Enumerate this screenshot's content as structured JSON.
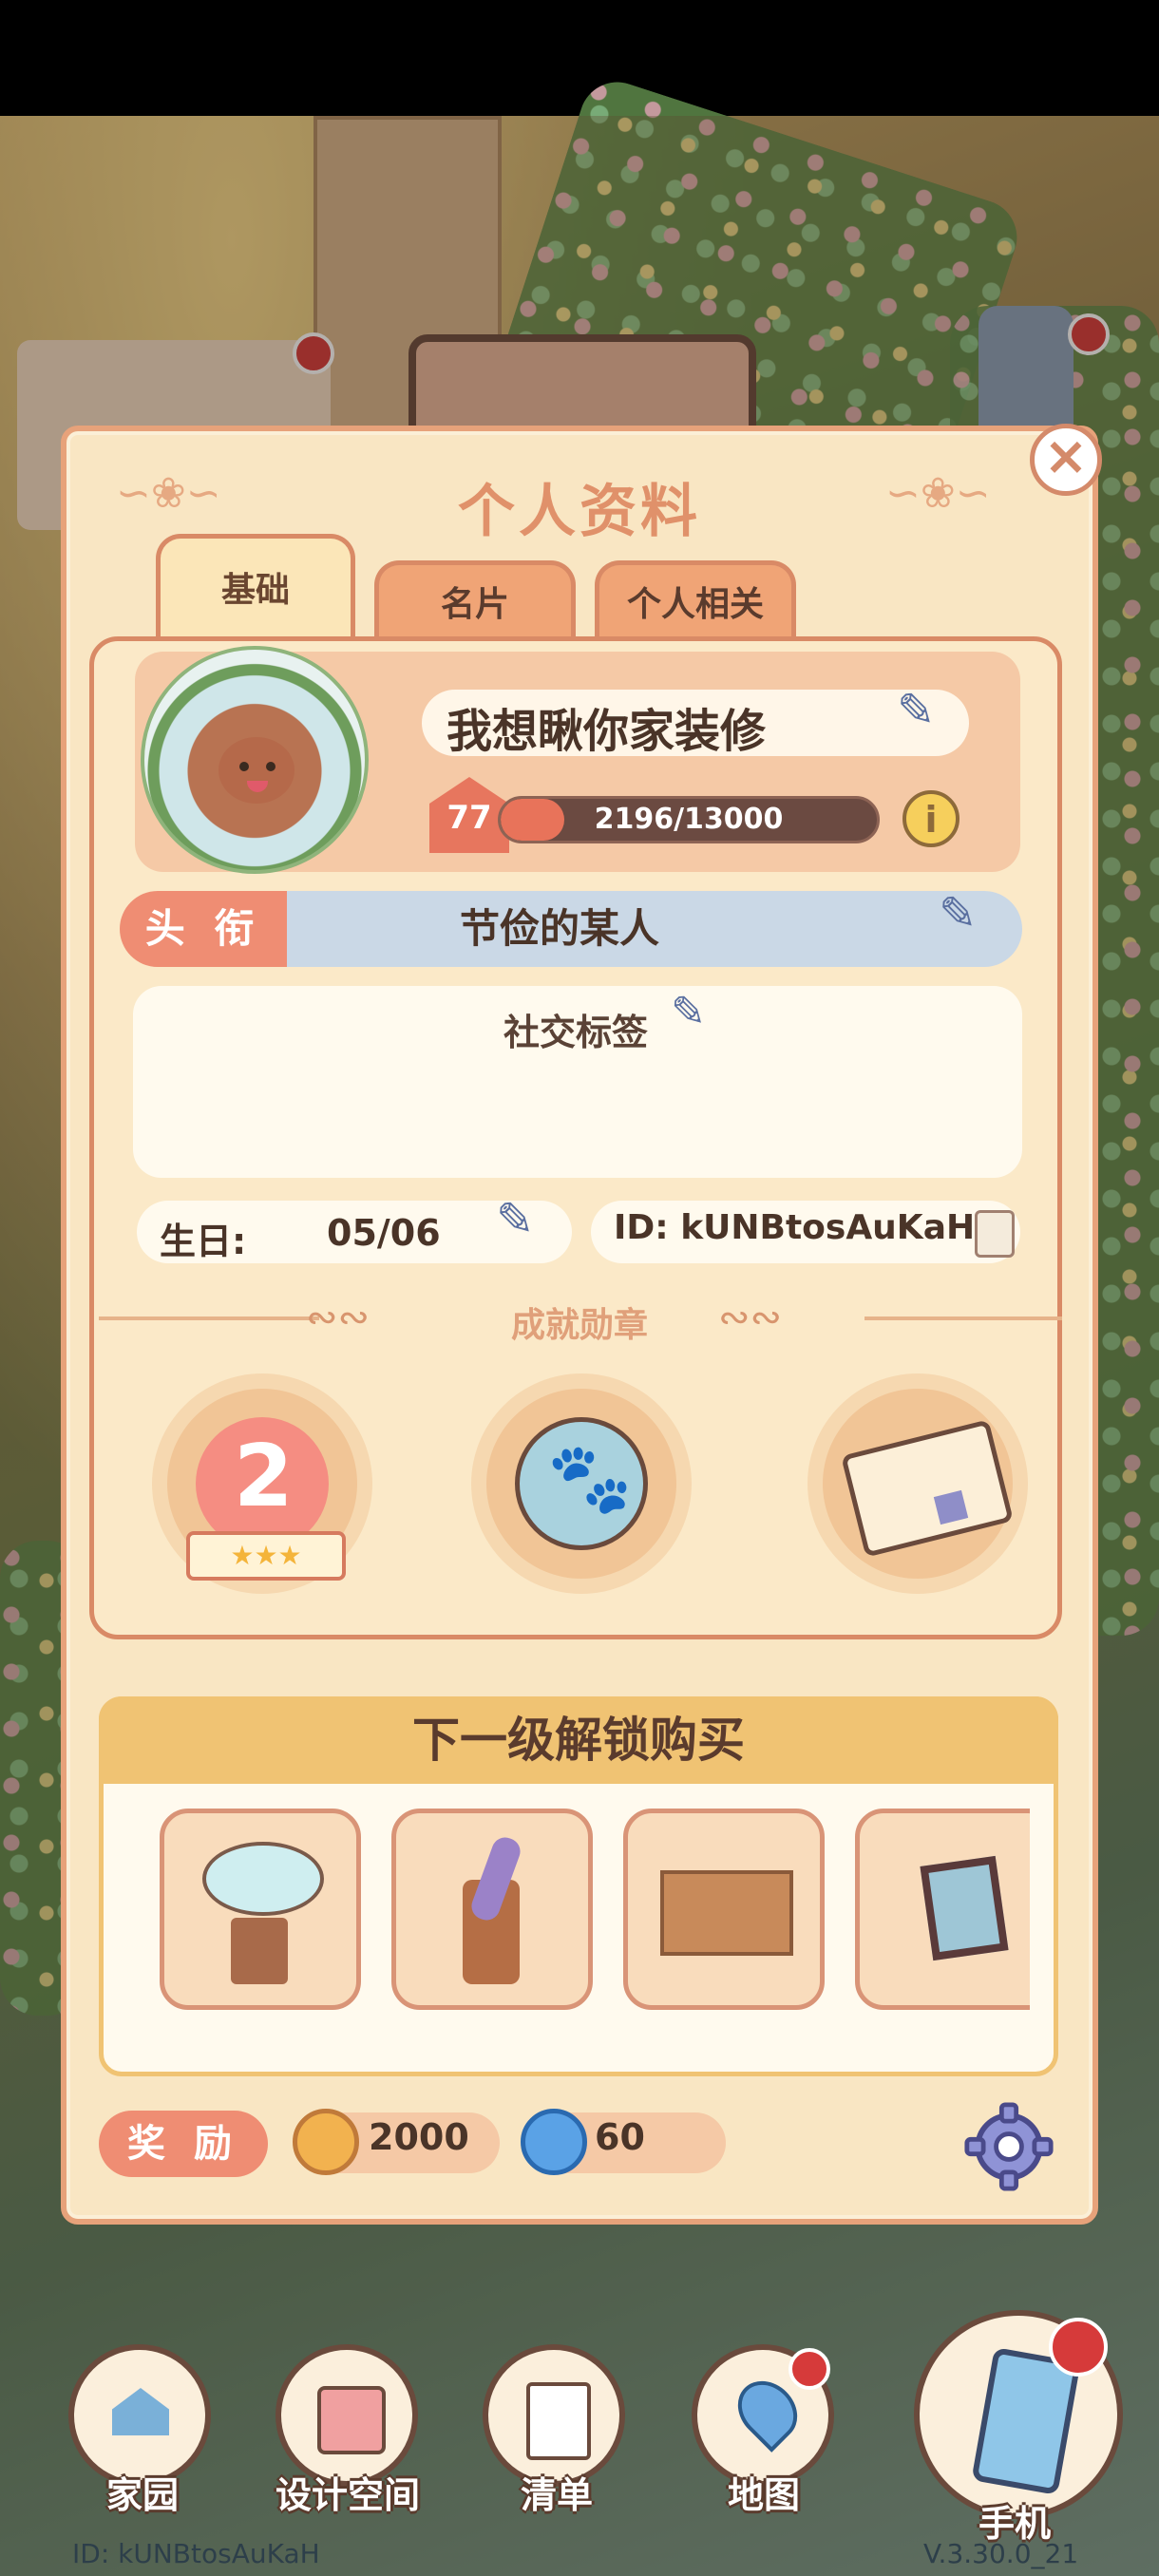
{
  "panel": {
    "title": "个人资料"
  },
  "tabs": [
    {
      "label": "基础",
      "active": true
    },
    {
      "label": "名片",
      "active": false
    },
    {
      "label": "个人相关",
      "active": false
    }
  ],
  "profile": {
    "nickname": "我想瞅你家装修",
    "level": "77",
    "xp_text": "2196/13000",
    "xp_fraction": 0.169,
    "title_label": "头 衔",
    "title_value": "节俭的某人",
    "social_tags_title": "社交标签",
    "birthday_label": "生日:",
    "birthday_value": "05/06",
    "id_text": "ID: kUNBtosAuKaH"
  },
  "achievements": {
    "title": "成就勋章",
    "medals": [
      {
        "name": "anniversary-2-medal"
      },
      {
        "name": "paw-medal"
      },
      {
        "name": "letter-medal"
      }
    ]
  },
  "unlock": {
    "title": "下一级解锁购买",
    "items": [
      "glass-table",
      "umbrella-stand",
      "wooden-cabinet",
      "framed-picture"
    ]
  },
  "reward": {
    "label": "奖 励",
    "coins": "2000",
    "gems": "60"
  },
  "nav": [
    {
      "label": "家园",
      "icon": "home-icon"
    },
    {
      "label": "设计空间",
      "icon": "design-icon"
    },
    {
      "label": "清单",
      "icon": "list-icon"
    },
    {
      "label": "地图",
      "icon": "map-icon"
    },
    {
      "label": "手机",
      "icon": "phone-icon"
    }
  ],
  "footer": {
    "player_id": "ID:  kUNBtosAuKaH",
    "version": "V.3.30.0_21"
  },
  "colors": {
    "panel_bg": "#f9e6c3",
    "accent": "#ef8d73",
    "xp_fill": "#e8735a",
    "title_bar": "#cad8e6",
    "unlock_header": "#f0c373"
  }
}
